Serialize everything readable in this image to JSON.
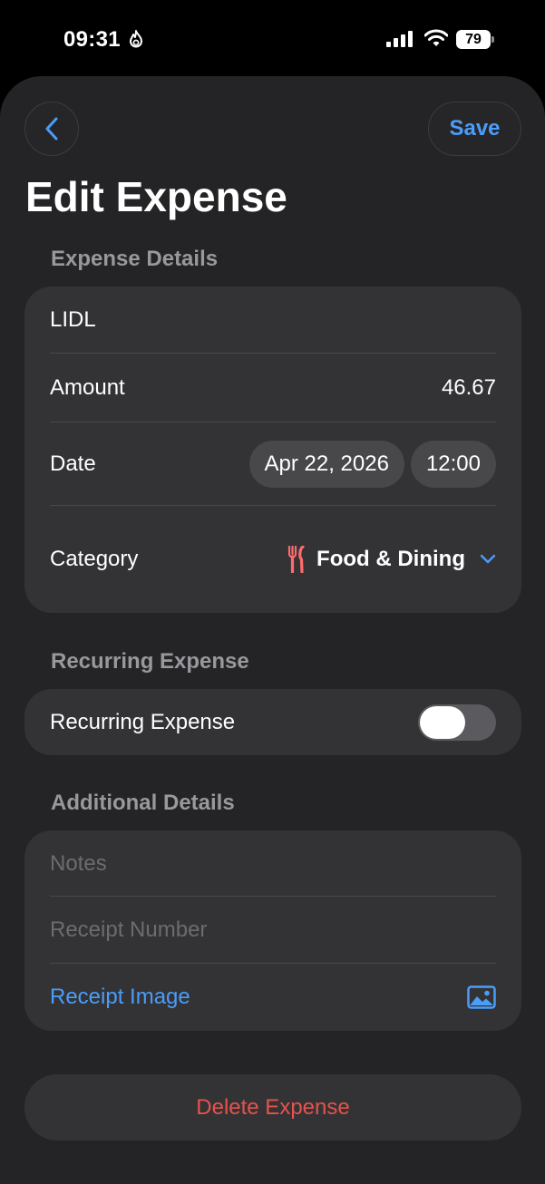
{
  "status_bar": {
    "time": "09:31",
    "battery": "79"
  },
  "nav": {
    "save_label": "Save"
  },
  "page": {
    "title": "Edit Expense"
  },
  "expense_details": {
    "header": "Expense Details",
    "name_value": "LIDL",
    "amount_label": "Amount",
    "amount_value": "46.67",
    "date_label": "Date",
    "date_value": "Apr 22, 2026",
    "time_value": "12:00",
    "category_label": "Category",
    "category_value": "Food & Dining",
    "category_icon": "fork-knife-icon",
    "category_icon_color": "#ff6b6b"
  },
  "recurring": {
    "header": "Recurring Expense",
    "toggle_label": "Recurring Expense",
    "toggle_on": false
  },
  "additional_details": {
    "header": "Additional Details",
    "notes_placeholder": "Notes",
    "receipt_number_placeholder": "Receipt Number",
    "receipt_image_label": "Receipt Image"
  },
  "delete_label": "Delete Expense",
  "colors": {
    "accent": "#4a9df8",
    "destructive": "#e5534b",
    "background": "#242426",
    "card": "#333336"
  }
}
